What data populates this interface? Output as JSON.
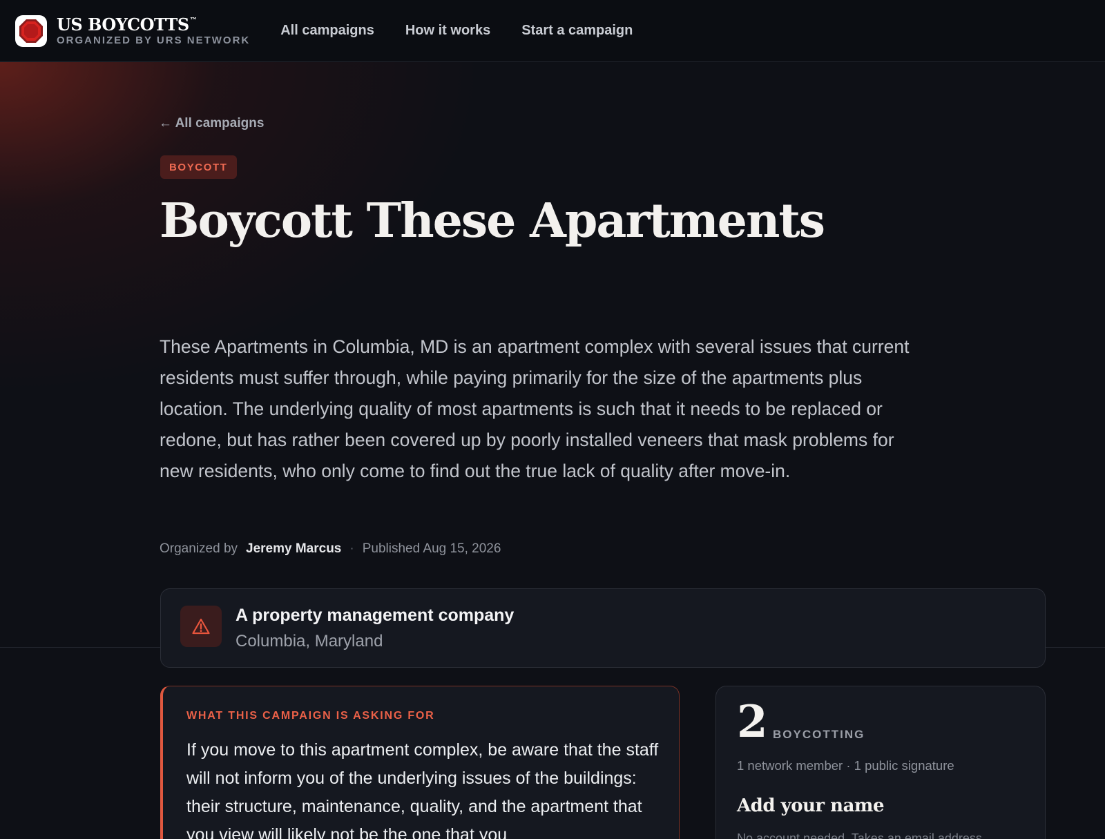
{
  "brand": {
    "name": "US BOYCOTTS",
    "trademark": "™",
    "tagline": "ORGANIZED BY URS NETWORK",
    "logo_icon": "octagon-logo-icon"
  },
  "nav": {
    "items": [
      {
        "label": "All campaigns"
      },
      {
        "label": "How it works"
      },
      {
        "label": "Start a campaign"
      }
    ]
  },
  "campaign": {
    "back_label": "← All campaigns",
    "tag": "BOYCOTT",
    "title": "Boycott These Apartments",
    "description": "These Apartments in Columbia, MD is an apartment complex with several issues that current residents must suffer through, while paying primarily for the size of the apartments plus location. The underlying quality of most apartments is such that it needs to be replaced or redone, but has rather been covered up by poorly installed veneers that mask problems for new residents, who only come to find out the true lack of quality after move-in.",
    "organized_by_label": "Organized by",
    "organizer": "Jeremy Marcus",
    "separator": "·",
    "published": "Published Aug 15, 2026",
    "target": {
      "icon": "warning-icon",
      "name": "A property management company",
      "location": "Columbia, Maryland"
    }
  },
  "ask": {
    "label": "WHAT THIS CAMPAIGN IS ASKING FOR",
    "text": "If you move to this apartment complex, be aware that the staff will not inform you of the underlying issues of the buildings: their structure, maintenance, quality, and the apartment that you view will likely not be the one that you"
  },
  "signup": {
    "count": "2",
    "count_label": "BOYCOTTING",
    "detail": "1 network member · 1 public signature",
    "title": "Add your name",
    "subtitle": "No account needed. Takes an email address."
  },
  "colors": {
    "accent": "#e0583f",
    "tag_bg": "#4b1d1c",
    "page_bg": "#0e1016",
    "card_bg": "#151820"
  }
}
